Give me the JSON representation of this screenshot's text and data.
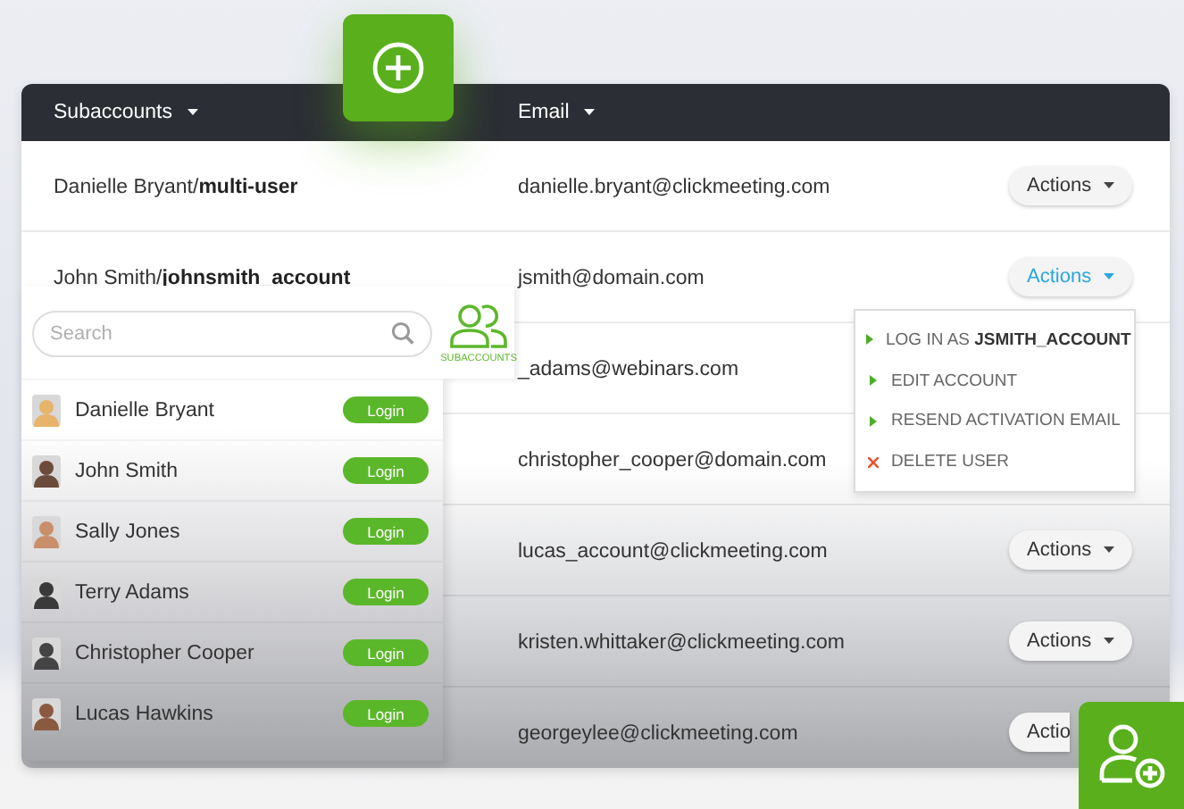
{
  "table": {
    "columns": [
      {
        "label": "Subaccounts"
      },
      {
        "label": "Email"
      }
    ],
    "rows": [
      {
        "name": "Danielle Bryant/**multi-user**",
        "email": "danielle.bryant@clickmeeting.com",
        "action": {
          "label": "Actions",
          "active": false
        }
      },
      {
        "name": "John Smith/**johnsmith_account**",
        "email": "jsmith@domain.com",
        "action": {
          "label": "Actions",
          "active": true
        }
      },
      {
        "email": "_adams@webinars.com"
      },
      {
        "email": "christopher_cooper@domain.com"
      },
      {
        "email": "lucas_account@clickmeeting.com",
        "action": {
          "label": "Actions",
          "active": false
        }
      },
      {
        "email": "kristen.whittaker@clickmeeting.com",
        "action": {
          "label": "Actions",
          "active": false
        }
      },
      {
        "email": "georgeylee@clickmeeting.com",
        "action": {
          "label": "Actio",
          "active": false,
          "caret": false
        }
      }
    ]
  },
  "actions_menu": {
    "items": [
      {
        "kind": "action",
        "label": "LOG IN AS **JSMITH_ACCOUNT**"
      },
      {
        "kind": "action",
        "label": "EDIT ACCOUNT"
      },
      {
        "kind": "action",
        "label": "RESEND ACTIVATION EMAIL"
      },
      {
        "kind": "delete",
        "label": "DELETE USER"
      }
    ]
  },
  "subaccounts_panel": {
    "search": {
      "placeholder": "Search"
    },
    "tab_label": "SUBACCOUNTS",
    "users": [
      {
        "name": "Danielle Bryant",
        "button": "Login"
      },
      {
        "name": "John Smith",
        "button": "Login"
      },
      {
        "name": "Sally Jones",
        "button": "Login"
      },
      {
        "name": "Terry Adams",
        "button": "Login"
      },
      {
        "name": "Christopher Cooper",
        "button": "Login"
      },
      {
        "name": "Lucas Hawkins",
        "button": "Login"
      }
    ]
  }
}
